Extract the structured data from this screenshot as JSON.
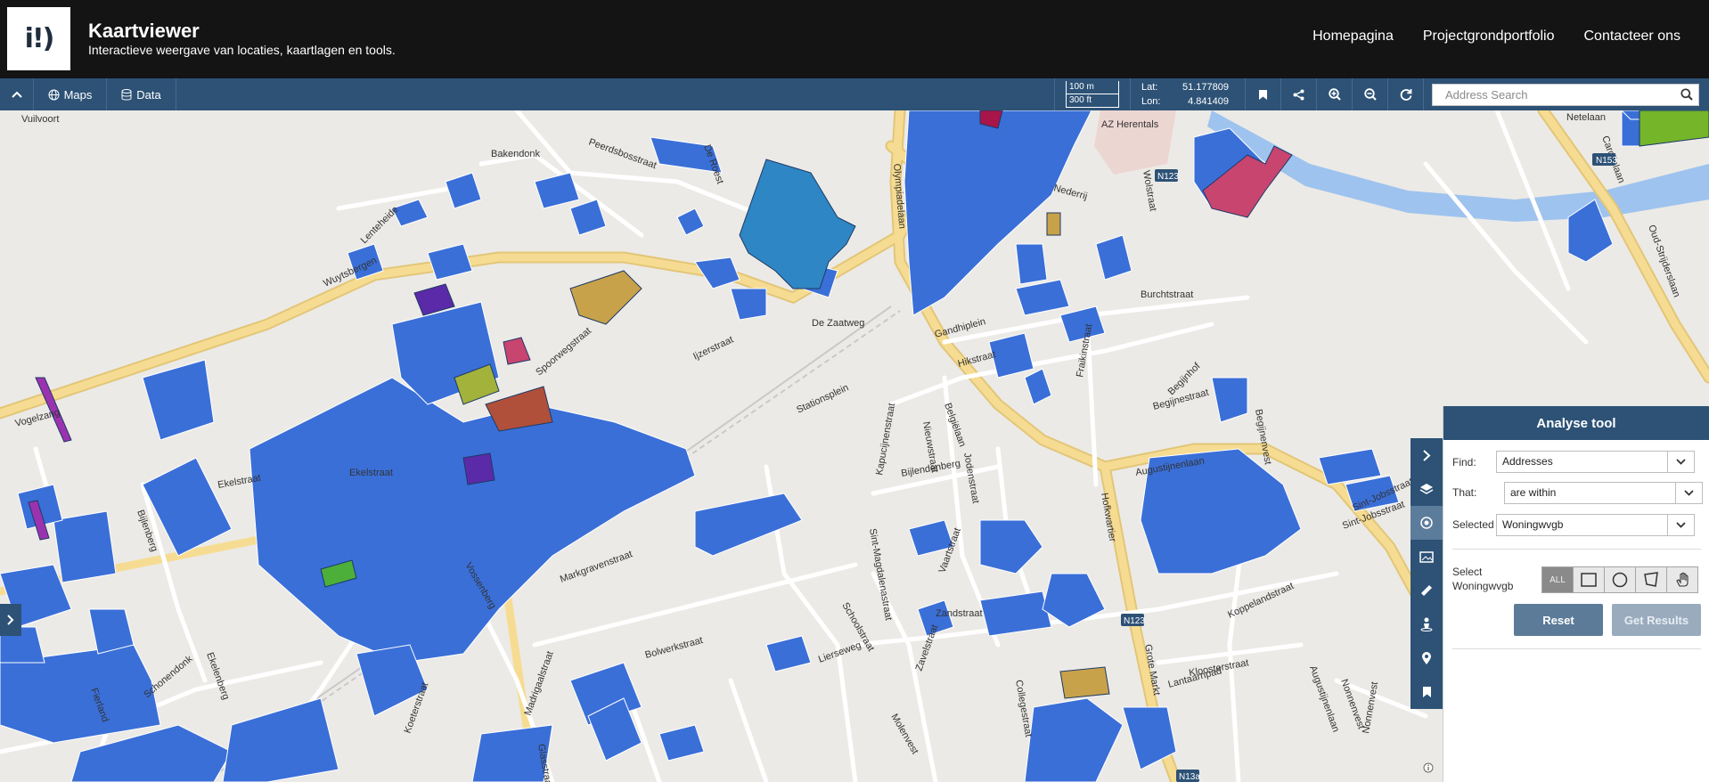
{
  "header": {
    "logo_text": "i!)",
    "title": "Kaartviewer",
    "subtitle": "Interactieve weergave van locaties, kaartlagen en tools.",
    "nav": [
      "Homepagina",
      "Projectgrondportfolio",
      "Contacteer ons"
    ]
  },
  "toolbar": {
    "collapse_icon": "chevron-up-icon",
    "maps_label": "Maps",
    "data_label": "Data",
    "scale_metric": "100 m",
    "scale_imperial": "300 ft",
    "lat_label": "Lat:",
    "lat_value": "51.177809",
    "lon_label": "Lon:",
    "lon_value": "4.841409",
    "icons": [
      "bookmark-icon",
      "share-icon",
      "zoom-in-icon",
      "zoom-out-icon",
      "refresh-icon"
    ],
    "search_placeholder": "Address Search"
  },
  "map": {
    "street_labels": [
      "Vuilvoort",
      "Bakendonk",
      "Peerdsbosstraat",
      "De Roest",
      "Olympiadelaan",
      "AZ Herentals",
      "Nederrij",
      "Netelaan",
      "Cardijnlaan",
      "Oud-Strijderslaan",
      "N153",
      "N123",
      "Lenteheide",
      "Wuytsbergen",
      "De Zaatweg",
      "Gandhiplein",
      "Burchtstraat",
      "Hikstraat",
      "Vogelzang",
      "Stationsplein",
      "Belgiëlaan",
      "Fraikinstraat",
      "Begijnhof",
      "Begijnenvest",
      "Augustijnenlaan",
      "Ekelstraat",
      "Bijlenberg",
      "Vossenberg",
      "Markgravenstraat",
      "Schoolstraat",
      "Zandstraat",
      "Hofkwartier",
      "Grote Markt",
      "Koppelandstraat",
      "Sint-Jobsstraat",
      "Kloosterstraat",
      "Lantaarnpad",
      "N13a",
      "Lierseweg",
      "Bolwerkstraat",
      "Schonendonk",
      "Madrigaalstraat",
      "Nieuwstraat",
      "Vaartstraat",
      "Molenvest",
      "Begijnestraat",
      "Sint-Magdalenastraat",
      "Collegestraat",
      "Glasstraat",
      "Koeterstraat",
      "Fierland",
      "Ekelenberg",
      "Bijlenberg",
      "Nonnenvest",
      "Spoorwegstraat",
      "Ijzerstraat",
      "Kapucijnenstraat",
      "Bijlendenberg",
      "Zavelstraat",
      "Jodenstraat"
    ],
    "colors": {
      "parcel_blue": "#3a6fd8",
      "parcel_steel": "#2f86c4",
      "parcel_purple": "#5b2aa8",
      "parcel_pink": "#c84570",
      "parcel_ochre": "#c8a24a",
      "parcel_green": "#74b52a",
      "parcel_olive": "#a3b23a",
      "parcel_rust": "#b0503a",
      "water": "#9ec3ef",
      "road_major": "#f6dc92",
      "background": "#eceae6"
    }
  },
  "tool_strip": {
    "icons": [
      "chevron-right-icon",
      "layers-icon",
      "analyse-icon",
      "image-icon",
      "ruler-icon",
      "person-icon",
      "location-pin-icon",
      "bookmark-icon"
    ]
  },
  "panel": {
    "title": "Analyse tool",
    "find_label": "Find:",
    "find_value": "Addresses",
    "that_label": "That:",
    "that_value": "are within",
    "selected_label": "Selected",
    "selected_value": "Woningwvgb",
    "select_label": "Select Woningwvgb",
    "shape_all_label": "ALL",
    "shape_icons": [
      "rectangle-select-icon",
      "circle-select-icon",
      "polygon-select-icon",
      "hand-select-icon"
    ],
    "reset_label": "Reset",
    "results_label": "Get Results"
  }
}
